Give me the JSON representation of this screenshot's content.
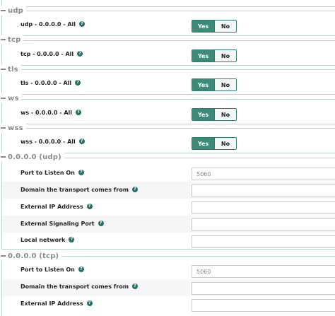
{
  "sections": {
    "udp": {
      "legend": "udp",
      "label": "udp - 0.0.0.0 - All",
      "yes": "Yes",
      "no": "No"
    },
    "tcp": {
      "legend": "tcp",
      "label": "tcp - 0.0.0.0 - All",
      "yes": "Yes",
      "no": "No"
    },
    "tls": {
      "legend": "tls",
      "label": "tls - 0.0.0.0 - All",
      "yes": "Yes",
      "no": "No"
    },
    "ws": {
      "legend": "ws",
      "label": "ws - 0.0.0.0 - All",
      "yes": "Yes",
      "no": "No"
    },
    "wss": {
      "legend": "wss",
      "label": "wss - 0.0.0.0 - All",
      "yes": "Yes",
      "no": "No"
    }
  },
  "udp_transport": {
    "legend": "0.0.0.0 (udp)",
    "port_label": "Port to Listen On",
    "port_placeholder": "5060",
    "domain_label": "Domain the transport comes from",
    "external_ip_label": "External IP Address",
    "external_sig_port_label": "External Signaling Port",
    "local_network_label": "Local network"
  },
  "tcp_transport": {
    "legend": "0.0.0.0 (tcp)",
    "port_label": "Port to Listen On",
    "port_placeholder": "5060",
    "domain_label": "Domain the transport comes from",
    "external_ip_label": "External IP Address"
  },
  "icons": {
    "help": "?",
    "collapse": "minus-icon"
  },
  "colors": {
    "yes_active": "#3b8b78",
    "border": "#b7d3cb",
    "help_icon": "#2a6e64"
  }
}
